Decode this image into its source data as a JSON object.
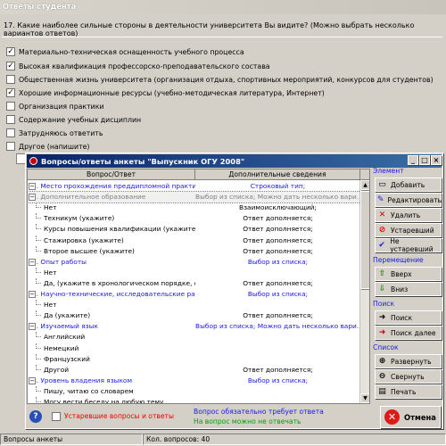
{
  "outer": {
    "title": "Ответы студента",
    "question": "17. Какие наиболее сильные стороны в деятельности университета Вы видите? (Можно выбрать несколько вариантов ответов)",
    "options": [
      {
        "label": "Материально-техническая оснащенность учебного процесса",
        "checked": true
      },
      {
        "label": "Высокая квалификация профессорско-преподавательского состава",
        "checked": true
      },
      {
        "label": "Общественная жизнь университета (организация отдыха, спортивных мероприятий, конкурсов для студентов)",
        "checked": false
      },
      {
        "label": "Хорошие информационные ресурсы (учебно-методическая литература, Интернет)",
        "checked": true
      },
      {
        "label": "Организация практики",
        "checked": false
      },
      {
        "label": "Содержание учебных дисциплин",
        "checked": false
      },
      {
        "label": "Затрудняюсь ответить",
        "checked": false
      },
      {
        "label": "Другое (напишите)",
        "checked": false
      }
    ]
  },
  "dialog": {
    "title": "Вопросы/ответы анкеты \"Выпускник ОГУ 2008\"",
    "col1": "Вопрос/Ответ",
    "col2": "Дополнительные сведения",
    "rows": [
      {
        "text": "1. Место прохождения преддипломной практики (г...",
        "info": "Строковый тип;",
        "style": "blue",
        "indent": 0
      },
      {
        "text": "2. Дополнительное образование",
        "info": "Выбор из списка; Можно дать несколько вари...",
        "style": "grey",
        "indent": 0
      },
      {
        "text": "Нет",
        "info": "Взаимоисключающий;",
        "style": "",
        "indent": 1
      },
      {
        "text": "Техникум (укажите)",
        "info": "Ответ дополняется;",
        "style": "",
        "indent": 1
      },
      {
        "text": "Курсы повышения квалификации (укажите)",
        "info": "Ответ дополняется;",
        "style": "",
        "indent": 1
      },
      {
        "text": "Стажировка (укажите)",
        "info": "Ответ дополняется;",
        "style": "",
        "indent": 1
      },
      {
        "text": "Второе высшее (укажите)",
        "info": "Ответ дополняется;",
        "style": "",
        "indent": 1
      },
      {
        "text": "3. Опыт работы",
        "info": "Выбор из списка;",
        "style": "blue",
        "indent": 0
      },
      {
        "text": "Нет",
        "info": "",
        "style": "",
        "indent": 1
      },
      {
        "text": "Да, (укажите в хронологическом порядке, от п...",
        "info": "Ответ дополняется;",
        "style": "",
        "indent": 1
      },
      {
        "text": "4. Научно-технические, исследовательские разра...",
        "info": "Выбор из списка;",
        "style": "blue",
        "indent": 0
      },
      {
        "text": "Нет",
        "info": "",
        "style": "",
        "indent": 1
      },
      {
        "text": "Да (укажите)",
        "info": "Ответ дополняется;",
        "style": "",
        "indent": 1
      },
      {
        "text": "5. Изучаемый язык",
        "info": "Выбор из списка; Можно дать несколько вари...",
        "style": "blue",
        "indent": 0
      },
      {
        "text": "Английский",
        "info": "",
        "style": "",
        "indent": 1
      },
      {
        "text": "Немецкий",
        "info": "",
        "style": "",
        "indent": 1
      },
      {
        "text": "Французский",
        "info": "",
        "style": "",
        "indent": 1
      },
      {
        "text": "Другой",
        "info": "Ответ дополняется;",
        "style": "",
        "indent": 1
      },
      {
        "text": "6. Уровень владения языком",
        "info": "Выбор из списка;",
        "style": "blue",
        "indent": 0
      },
      {
        "text": "Пишу, читаю со словарем",
        "info": "",
        "style": "",
        "indent": 1
      },
      {
        "text": "Могу вести беседу на любую тему",
        "info": "",
        "style": "",
        "indent": 1
      }
    ],
    "groups": {
      "element": "Элемент",
      "move": "Перемещение",
      "search": "Поиск",
      "list": "Список"
    },
    "buttons": {
      "add": "Добавить",
      "edit": "Редактировать",
      "delete": "Удалить",
      "obsolete": "Устаревший",
      "not_obsolete": "Не устаревший",
      "up": "Вверх",
      "down": "Вниз",
      "search": "Поиск",
      "search_next": "Поиск далее",
      "expand": "Развернуть",
      "collapse": "Свернуть",
      "print": "Печать",
      "cancel": "Отмена"
    },
    "legend": {
      "obsolete_cb": "Устаревшие вопросы и ответы",
      "required": "Вопрос обязательно требует ответа",
      "optional": "На вопрос можно не отвечать"
    }
  },
  "status": {
    "left": "Вопросы анкеты",
    "count": "Кол. вопросов: 40"
  }
}
